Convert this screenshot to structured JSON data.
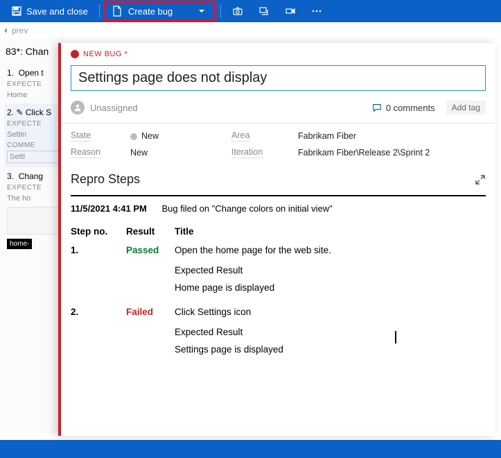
{
  "topbar": {
    "save_close": "Save and close",
    "create_bug": "Create bug"
  },
  "prev": "prev",
  "bg": {
    "title": "83*: Chan",
    "steps": [
      {
        "num": "1.",
        "name": "Open t",
        "exp": "EXPECTE",
        "val": "Home"
      },
      {
        "num": "2.",
        "name": "Click S",
        "exp": "EXPECTE",
        "val": "Settin",
        "comm": "COMME",
        "commval": "Setti"
      },
      {
        "num": "3.",
        "name": "Chang",
        "exp": "EXPECTE",
        "val": "The ho"
      }
    ],
    "chip": "home-"
  },
  "bug": {
    "badge": "NEW BUG *",
    "title": "Settings page does not display",
    "unassigned": "Unassigned",
    "comments_count": "0 comments",
    "add_tag": "Add tag",
    "fields": {
      "state_label": "State",
      "state_val": "New",
      "area_label": "Area",
      "area_val": "Fabrikam Fiber",
      "reason_label": "Reason",
      "reason_val": "New",
      "iter_label": "Iteration",
      "iter_val": "Fabrikam Fiber\\Release 2\\Sprint 2"
    },
    "section": "Repro Steps",
    "repro": {
      "date": "11/5/2021 4:41 PM",
      "filed_on": "Bug filed on \"Change colors on initial view\"",
      "headers": {
        "step": "Step no.",
        "result": "Result",
        "title": "Title"
      },
      "rows": [
        {
          "num": "1.",
          "result": "Passed",
          "title": "Open the home page for the web site.",
          "exp_label": "Expected Result",
          "exp_text": "Home page is displayed"
        },
        {
          "num": "2.",
          "result": "Failed",
          "title": "Click Settings icon",
          "exp_label": "Expected Result",
          "exp_text": "Settings page is displayed"
        }
      ]
    }
  }
}
